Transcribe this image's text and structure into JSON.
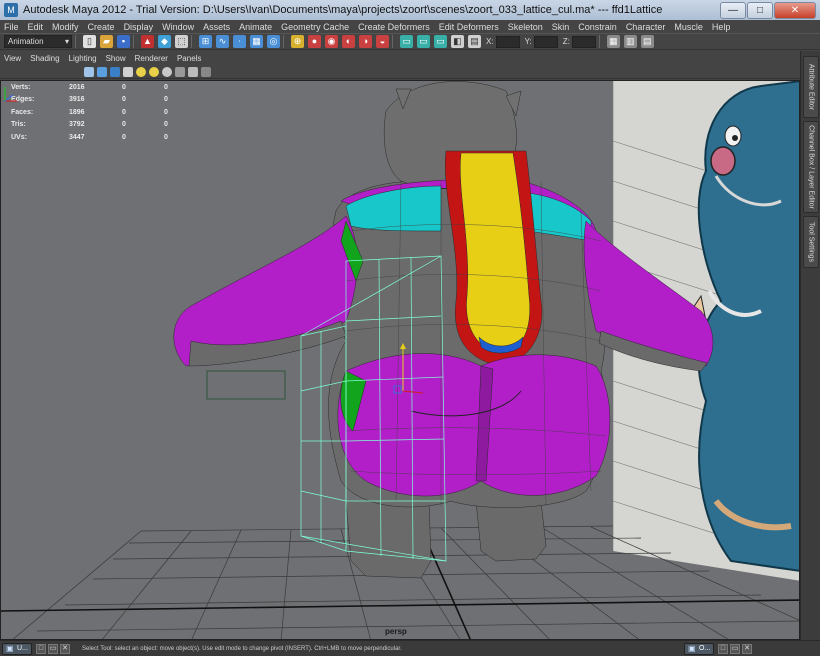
{
  "window": {
    "title": "Autodesk Maya 2012 - Trial Version: D:\\Users\\Ivan\\Documents\\maya\\projects\\zoort\\scenes\\zoort_033_lattice_cul.ma*   ---   ffd1Lattice",
    "minimize": "—",
    "maximize": "□",
    "close": "✕"
  },
  "menubar": [
    "File",
    "Edit",
    "Modify",
    "Create",
    "Display",
    "Window",
    "Assets",
    "Animate",
    "Geometry Cache",
    "Create Deformers",
    "Edit Deformers",
    "Skeleton",
    "Skin",
    "Constrain",
    "Character",
    "Muscle",
    "Help"
  ],
  "statusline": {
    "mode": "Animation",
    "x_label": "X:",
    "y_label": "Y:",
    "z_label": "Z:"
  },
  "panel_menu": [
    "View",
    "Shading",
    "Lighting",
    "Show",
    "Renderer",
    "Panels"
  ],
  "hud": {
    "rows": [
      {
        "label": "Verts:",
        "v1": "2016",
        "v2": "0",
        "v3": "0"
      },
      {
        "label": "Edges:",
        "v1": "3916",
        "v2": "0",
        "v3": "0"
      },
      {
        "label": "Faces:",
        "v1": "1896",
        "v2": "0",
        "v3": "0"
      },
      {
        "label": "Tris:",
        "v1": "3792",
        "v2": "0",
        "v3": "0"
      },
      {
        "label": "UVs:",
        "v1": "3447",
        "v2": "0",
        "v3": "0"
      }
    ]
  },
  "viewport": {
    "camera": "persp",
    "background": "#6e7074",
    "model_colors": {
      "body": "#6a6a6a",
      "magenta": "#b21fc9",
      "yellow": "#e6cf15",
      "red": "#c41515",
      "cyan": "#18c7c9",
      "green": "#12a41d",
      "blue": "#1d5fcf",
      "lattice": "#7fffd4"
    }
  },
  "right_dock": {
    "tabs": [
      "Attribute Editor",
      "Channel Box / Layer Editor",
      "Tool Settings"
    ]
  },
  "helpline": {
    "text": "Select Tool: select an object: move object(s). Use edit mode to change pivot (INSERT).  Ctrl+LMB to move perpendicular.",
    "task_left": "U...",
    "task_right": "O..."
  }
}
